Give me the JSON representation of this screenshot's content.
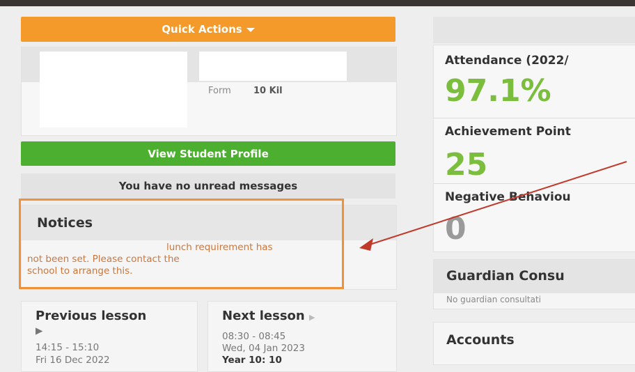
{
  "quick_actions": {
    "label": "Quick Actions"
  },
  "student": {
    "form_label": "Form",
    "form_value": "10 Kil"
  },
  "buttons": {
    "view_profile": "View Student Profile"
  },
  "messages": {
    "text": "You have no unread messages"
  },
  "notices": {
    "title": "Notices",
    "line1": "lunch requirement has",
    "line2": "not been set. Please contact the",
    "line3": "school to arrange this."
  },
  "lessons": {
    "previous": {
      "title": "Previous lesson",
      "arrow": "▶",
      "time": "14:15 - 15:10",
      "date": "Fri 16 Dec 2022"
    },
    "next": {
      "title": "Next lesson",
      "arrow": "▶",
      "time": "08:30 - 08:45",
      "date": "Wed, 04 Jan 2023",
      "group": "Year 10: 10"
    }
  },
  "stats": {
    "attendance_label": "Attendance (2022/",
    "attendance_value": "97.1%",
    "achievement_label": "Achievement Point",
    "achievement_value": "25",
    "negative_label": "Negative Behaviou",
    "negative_value": "0"
  },
  "guardian": {
    "title": "Guardian Consu",
    "text": "No guardian consultati"
  },
  "accounts": {
    "title": "Accounts"
  },
  "colors": {
    "accent_orange": "#f39a2a",
    "success_green": "#4caf2f",
    "stat_green": "#7bbd3c",
    "notice_text": "#c87840",
    "annotation_red": "#c0392b"
  }
}
